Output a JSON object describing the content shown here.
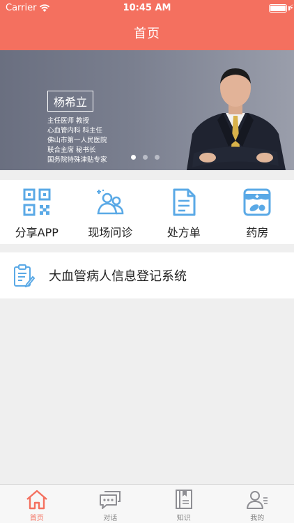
{
  "status": {
    "carrier": "Carrier",
    "time": "10:45 AM"
  },
  "header": {
    "title": "首页"
  },
  "banner": {
    "name": "杨希立",
    "lines": [
      "主任医师 教授",
      "心血管内科 科主任",
      "佛山市第一人民医院",
      "联合主席 秘书长",
      "国务院特殊津贴专家"
    ],
    "page_count": 3,
    "active_page": 1
  },
  "menu": {
    "items": [
      {
        "label": "分享APP",
        "icon": "qr-code-icon"
      },
      {
        "label": "现场问诊",
        "icon": "people-icon"
      },
      {
        "label": "处方单",
        "icon": "document-icon"
      },
      {
        "label": "药房",
        "icon": "pharmacy-icon"
      }
    ]
  },
  "system": {
    "label": "大血管病人信息登记系统",
    "icon": "clipboard-icon"
  },
  "tabbar": {
    "items": [
      {
        "label": "首页",
        "icon": "home-icon",
        "active": true
      },
      {
        "label": "对话",
        "icon": "chat-icon",
        "active": false
      },
      {
        "label": "知识",
        "icon": "book-icon",
        "active": false
      },
      {
        "label": "我的",
        "icon": "user-icon",
        "active": false
      }
    ]
  },
  "colors": {
    "accent": "#f4705f",
    "icon_blue": "#5aa9e6",
    "background": "#efefef"
  }
}
